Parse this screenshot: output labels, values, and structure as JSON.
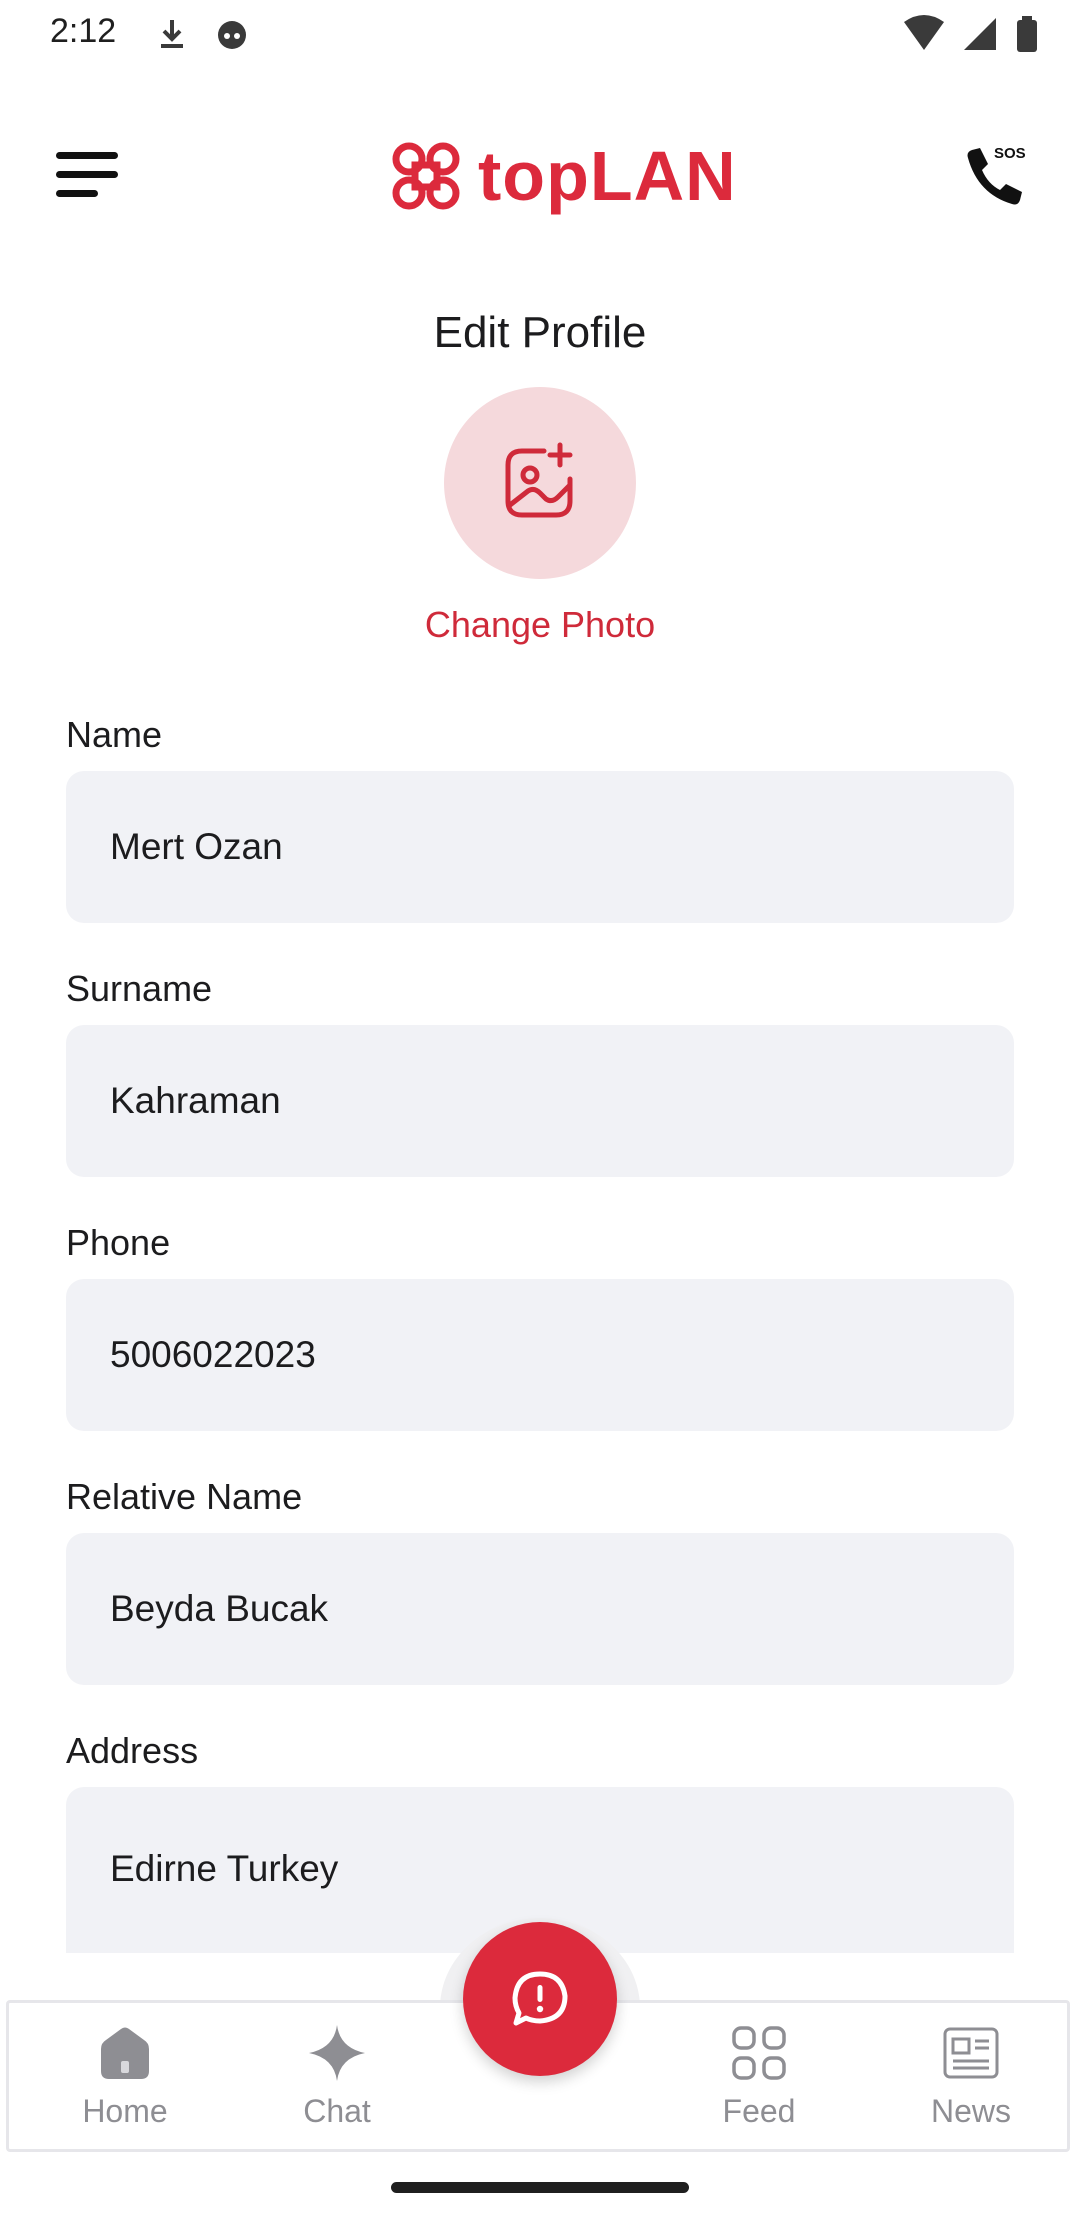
{
  "status_bar": {
    "time": "2:12",
    "icons": [
      "download-icon",
      "cat-face-icon",
      "wifi-icon",
      "signal-icon",
      "battery-icon"
    ]
  },
  "header": {
    "logo_text": "topLAN",
    "brand_color": "#dc2a3c",
    "menu_icon": "menu-icon",
    "sos_icon": "sos-phone-icon",
    "sos_label": "SOS"
  },
  "page": {
    "title": "Edit Profile",
    "change_photo_label": "Change Photo",
    "avatar_icon": "image-add-icon"
  },
  "form": {
    "fields": [
      {
        "label": "Name",
        "value": "Mert Ozan"
      },
      {
        "label": "Surname",
        "value": "Kahraman"
      },
      {
        "label": "Phone",
        "value": "5006022023"
      },
      {
        "label": "Relative Name",
        "value": "Beyda Bucak"
      },
      {
        "label": "Address",
        "value": "Edirne Turkey"
      }
    ]
  },
  "bottom_nav": {
    "items": [
      {
        "label": "Home",
        "icon": "home-icon",
        "active": false
      },
      {
        "label": "Chat",
        "icon": "sparkle-icon",
        "active": false
      },
      {
        "label": "Feed",
        "icon": "grid-icon",
        "active": false
      },
      {
        "label": "News",
        "icon": "newspaper-icon",
        "active": false
      }
    ],
    "fab_icon": "alert-chat-icon"
  },
  "colors": {
    "accent": "#dc2a3c",
    "input_bg": "#f1f2f6",
    "avatar_bg": "#f5d9dc",
    "nav_inactive": "#8e8e93"
  }
}
